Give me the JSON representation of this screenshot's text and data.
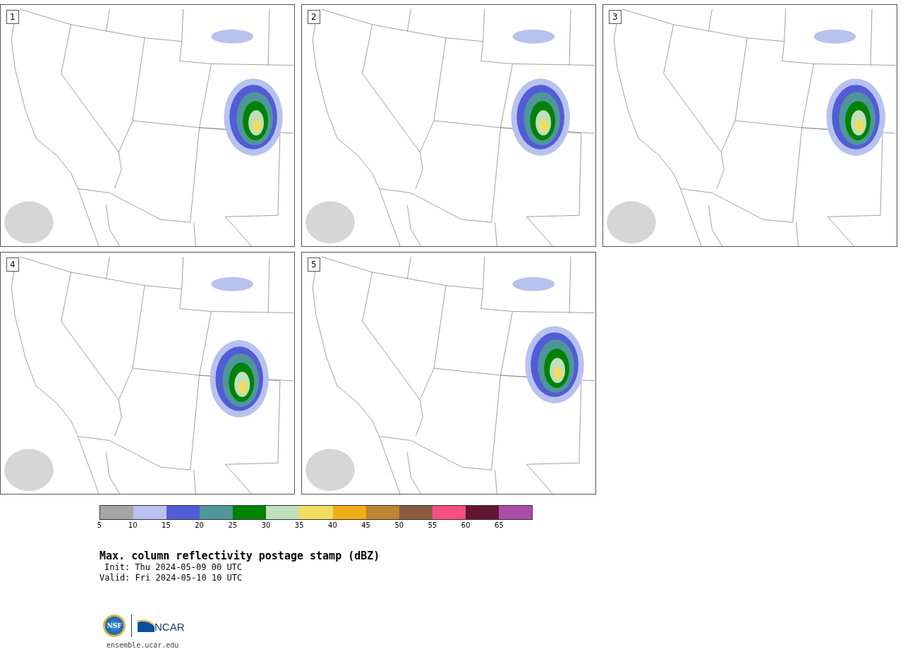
{
  "panels": [
    {
      "label": "1"
    },
    {
      "label": "2"
    },
    {
      "label": "3"
    },
    {
      "label": "4"
    },
    {
      "label": "5"
    }
  ],
  "colorbar": {
    "segments": [
      {
        "color": "#a5a5a5"
      },
      {
        "color": "#b8c2ee"
      },
      {
        "color": "#525cd6"
      },
      {
        "color": "#4f969b"
      },
      {
        "color": "#008300"
      },
      {
        "color": "#bfdfbd"
      },
      {
        "color": "#f1dc5f"
      },
      {
        "color": "#f0ad18"
      },
      {
        "color": "#bd8432"
      },
      {
        "color": "#8b5b3f"
      },
      {
        "color": "#f5507f"
      },
      {
        "color": "#611734"
      },
      {
        "color": "#ad4ca5"
      }
    ],
    "ticks": [
      "5",
      "10",
      "15",
      "20",
      "25",
      "30",
      "35",
      "40",
      "45",
      "50",
      "55",
      "60",
      "65"
    ]
  },
  "title": "Max. column reflectivity postage stamp (dBZ)",
  "init": "Init: Thu 2024-05-09 00 UTC",
  "valid": "Valid: Fri 2024-05-10 10 UTC",
  "logo": {
    "nsf": "NSF",
    "ncar": "NCAR"
  },
  "site": "ensemble.ucar.edu"
}
